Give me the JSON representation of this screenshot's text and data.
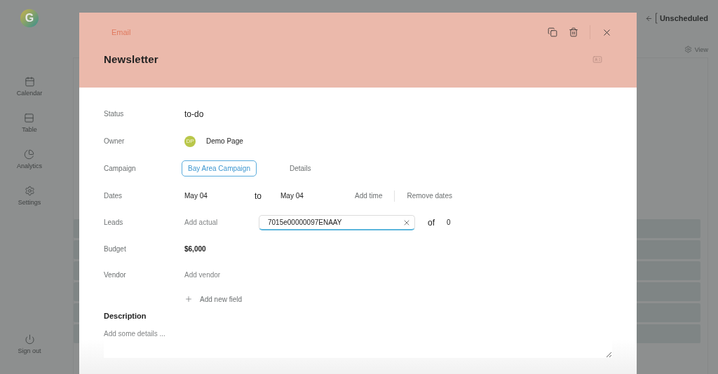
{
  "sidebar": {
    "logo": "G",
    "items": [
      {
        "label": "Calendar",
        "kind": "calendar",
        "selected": false
      },
      {
        "label": "Table",
        "kind": "table",
        "selected": false
      },
      {
        "label": "Analytics",
        "kind": "analytics",
        "selected": false
      },
      {
        "label": "Settings",
        "kind": "settings",
        "selected": false
      }
    ],
    "sign_out": "Sign out"
  },
  "topbar": {
    "back_label": "Unscheduled",
    "view_button": "View"
  },
  "modal": {
    "type_label": "Email",
    "title": "Newsletter",
    "fields": [
      {
        "kind": "text",
        "label": "Status",
        "value": "to-do"
      },
      {
        "kind": "owner",
        "label": "Owner",
        "initials": "DP",
        "value": "Demo Page"
      },
      {
        "kind": "campaign",
        "label": "Campaign",
        "value": "Bay Area Campaign",
        "link": "Details"
      },
      {
        "kind": "dates",
        "label": "Dates",
        "start": "May 04",
        "separator": "to",
        "end": "May 04",
        "add_time": "Add time",
        "remove": "Remove dates"
      },
      {
        "kind": "leads",
        "label": "Leads",
        "placeholder": "Add actual",
        "value": "7015e00000097ENAAY",
        "of": "of",
        "total": "0"
      },
      {
        "kind": "strong",
        "label": "Budget",
        "value": "$6,000"
      },
      {
        "kind": "empty",
        "label": "Vendor",
        "placeholder": "Add vendor"
      }
    ],
    "add_field": "Add new field",
    "description_title": "Description",
    "description_placeholder": "Add some details ..."
  }
}
